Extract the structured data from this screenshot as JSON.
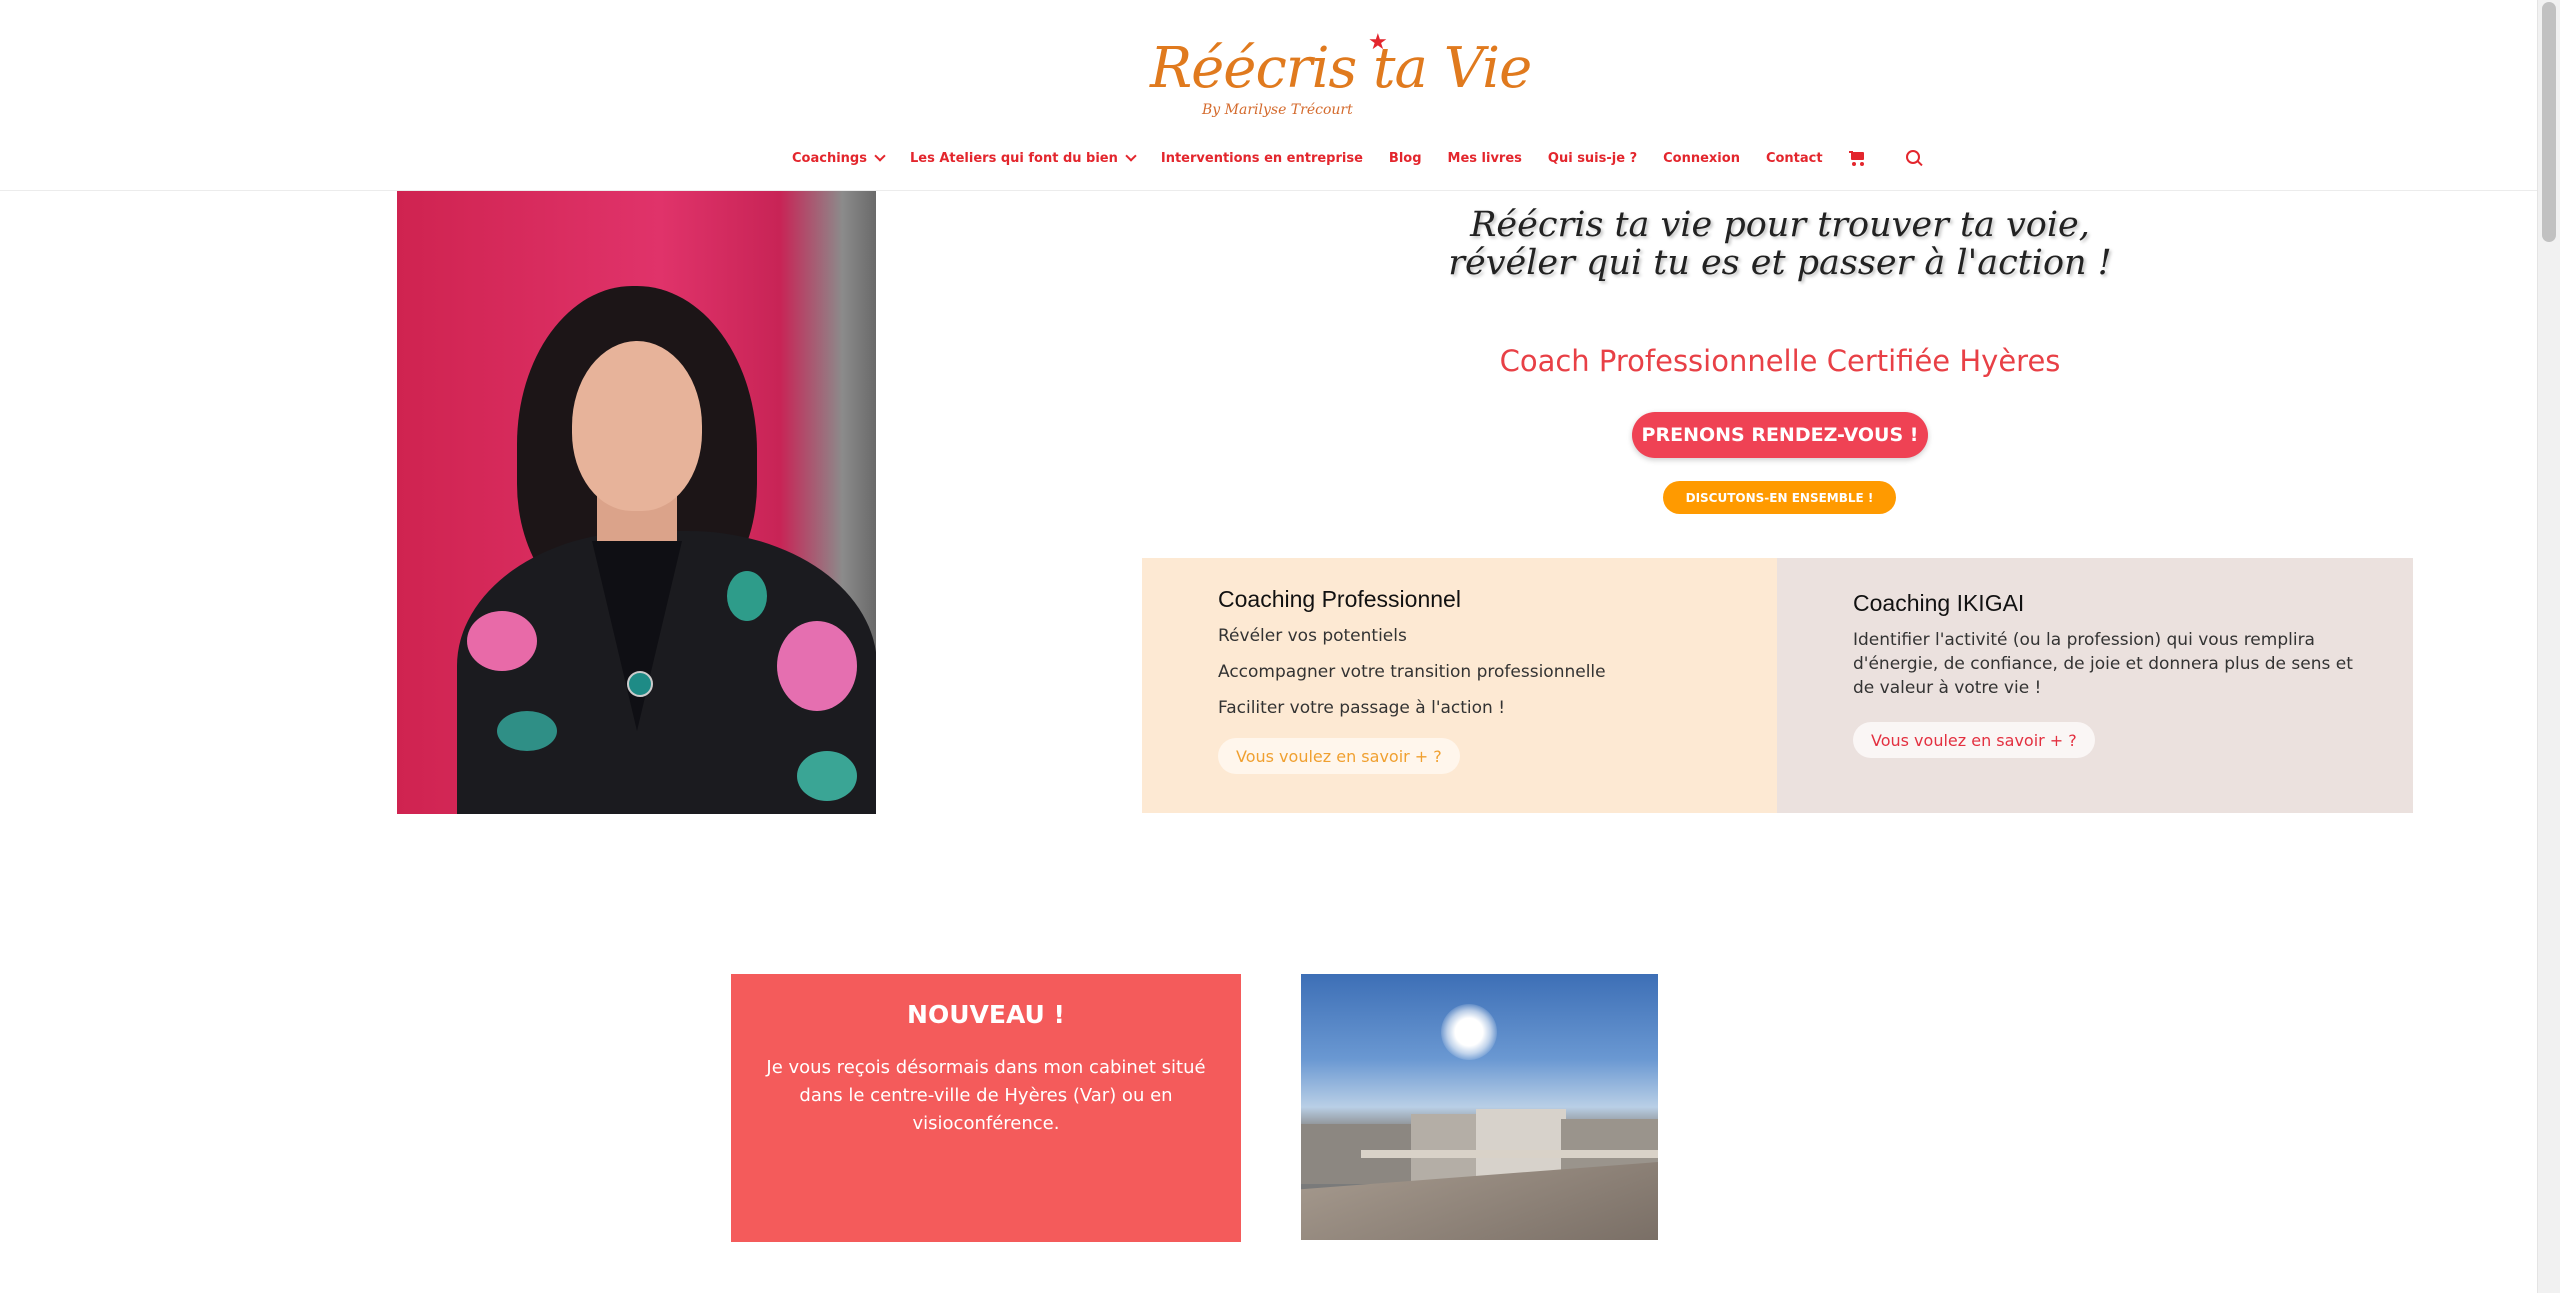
{
  "header": {
    "logo": {
      "main": "Réécris ta Vie",
      "sub": "By Marilyse Trécourt"
    },
    "nav": [
      {
        "label": "Coachings",
        "has_dropdown": true
      },
      {
        "label": "Les Ateliers qui font du bien",
        "has_dropdown": true
      },
      {
        "label": "Interventions en entreprise",
        "has_dropdown": false
      },
      {
        "label": "Blog",
        "has_dropdown": false
      },
      {
        "label": "Mes livres",
        "has_dropdown": false
      },
      {
        "label": "Qui suis-je ?",
        "has_dropdown": false
      },
      {
        "label": "Connexion",
        "has_dropdown": false
      },
      {
        "label": "Contact",
        "has_dropdown": false
      }
    ],
    "icons": [
      "cart-icon",
      "search-icon"
    ],
    "accent_color": "#e3262d"
  },
  "hero": {
    "tagline": {
      "line1": "Réécris ta vie pour trouver ta voie,",
      "line2": "révéler qui tu es et passer à l'action !"
    },
    "coach_title": "Coach Professionnelle Certifiée Hyères",
    "cta_primary": "PRENONS RENDEZ-VOUS !",
    "cta_secondary": "DISCUTONS-EN ENSEMBLE !"
  },
  "cards": {
    "pro": {
      "title": "Coaching Professionnel",
      "lines": [
        "Révéler vos potentiels",
        "Accompagner votre transition professionnelle",
        "Faciliter votre passage à l'action !"
      ],
      "more": "Vous voulez en savoir + ?"
    },
    "ikigai": {
      "title": "Coaching IKIGAI",
      "lines": [
        "Identifier l'activité (ou la profession) qui vous remplira",
        "d'énergie, de confiance, de joie et donnera plus de sens et",
        "de valeur  à votre vie !"
      ],
      "more": "Vous voulez en savoir + ?"
    }
  },
  "news": {
    "title": "NOUVEAU !",
    "text": "Je vous reçois désormais dans mon cabinet situé dans le centre-ville de Hyères (Var) ou en visioconférence."
  },
  "colors": {
    "brand_red": "#e3262d",
    "cta_red": "#ef4254",
    "cta_orange": "#ff9a00",
    "card_pro_bg": "#fde9d3",
    "card_ikigai_bg": "#ebe1de",
    "news_bg": "#f45b5b"
  }
}
